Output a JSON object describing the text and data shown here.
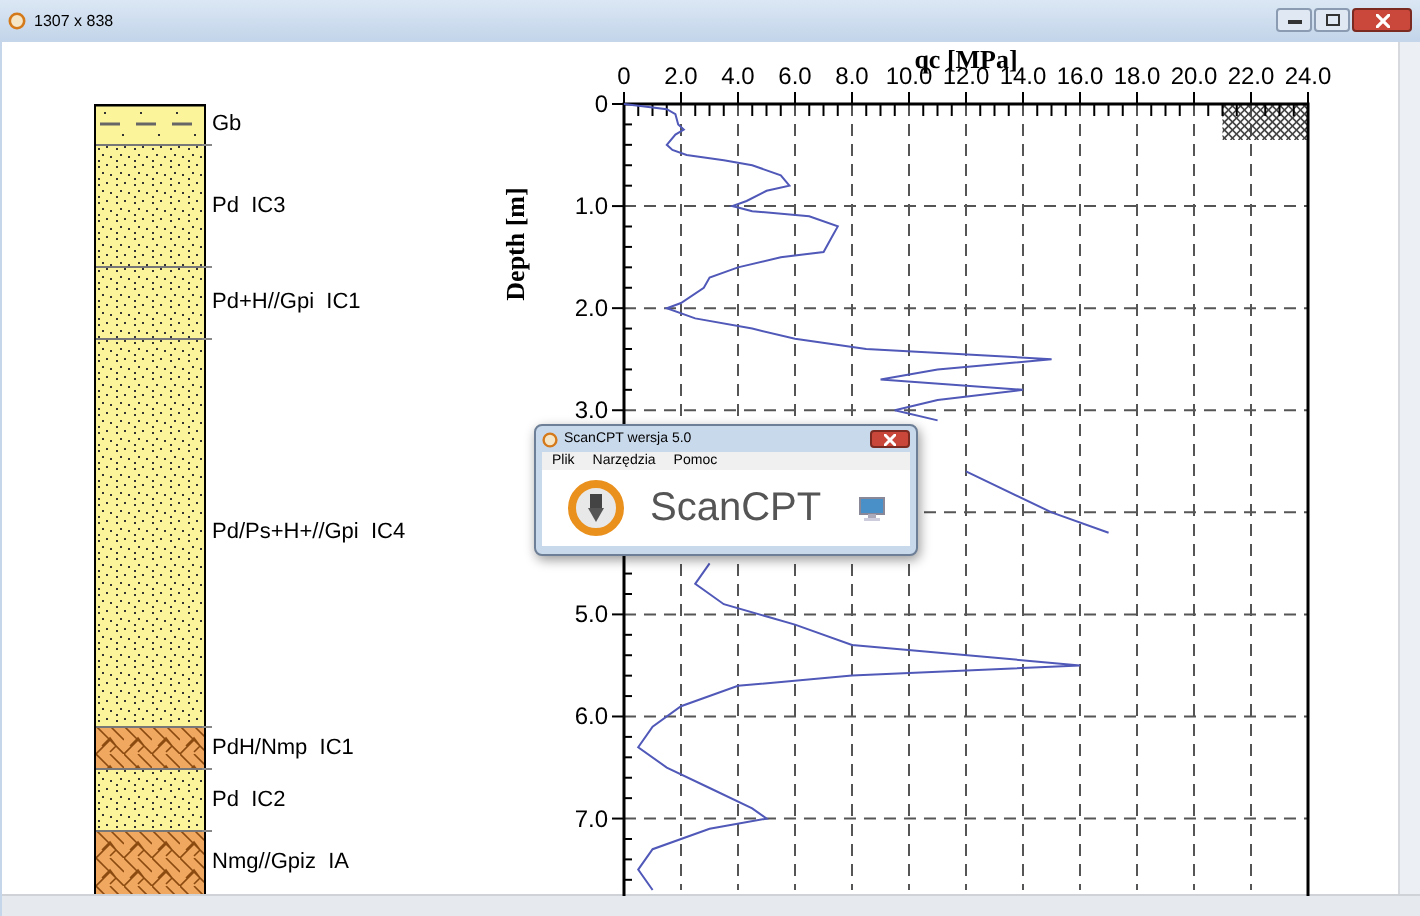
{
  "window": {
    "title": "1307 x 838"
  },
  "strata": [
    {
      "name": "Gb",
      "kind": "fill"
    },
    {
      "name": "Pd  IC3",
      "kind": "sand"
    },
    {
      "name": "Pd+H//Gpi  IC1",
      "kind": "sand"
    },
    {
      "name": "Pd/Ps+H+//Gpi  IC4",
      "kind": "sand"
    },
    {
      "name": "PdH/Nmp  IC1",
      "kind": "clay"
    },
    {
      "name": "Pd  IC2",
      "kind": "sand"
    },
    {
      "name": "Nmg//Gpiz  IA",
      "kind": "clay"
    }
  ],
  "chart": {
    "chart_data": {
      "type": "line",
      "xlabel": "qc [MPa]",
      "ylabel": "Depth [m]",
      "x": [
        0,
        1.5,
        1.8,
        1.9,
        2.1,
        1.8,
        1.5,
        1.7,
        2.2,
        3.5,
        4.5,
        5.5,
        5.8,
        5.0,
        4.3,
        3.8,
        4.5,
        6.5,
        7.5,
        7.3,
        7.0,
        5.5,
        4.0,
        3.0,
        2.8,
        2.0,
        1.5,
        2.5,
        4.5,
        6.0,
        8.5,
        15.0,
        11.0,
        9.0,
        14.0,
        11.0,
        9.5,
        11.0,
        null,
        12.0,
        15.0,
        17.0,
        null,
        3.0,
        2.5,
        3.5,
        6.0,
        8.0,
        16.0,
        8.0,
        4.0,
        2.0,
        1.0,
        0.5,
        1.5,
        3.0,
        4.5,
        5.0,
        3.0,
        1.0,
        0.5,
        1.0
      ],
      "series": [
        {
          "color": "#5058b8",
          "values": [
            0,
            0.05,
            0.1,
            0.2,
            0.25,
            0.3,
            0.4,
            0.45,
            0.5,
            0.55,
            0.6,
            0.7,
            0.8,
            0.85,
            0.95,
            1.0,
            1.05,
            1.1,
            1.2,
            1.3,
            1.45,
            1.5,
            1.6,
            1.7,
            1.8,
            1.95,
            2.0,
            2.1,
            2.2,
            2.3,
            2.4,
            2.5,
            2.6,
            2.7,
            2.8,
            2.9,
            3.0,
            3.1,
            null,
            3.6,
            4.0,
            4.2,
            null,
            4.5,
            4.7,
            4.9,
            5.1,
            5.3,
            5.5,
            5.6,
            5.7,
            5.9,
            6.1,
            6.3,
            6.5,
            6.7,
            6.9,
            7.0,
            7.1,
            7.3,
            7.5,
            7.7
          ]
        }
      ],
      "xlim": [
        0,
        24
      ],
      "ylim": [
        7.7,
        0
      ],
      "grid": true,
      "xticks": [
        {
          "value": 0,
          "label": "0"
        },
        {
          "value": 2,
          "label": "2.0"
        },
        {
          "value": 4,
          "label": "4.0"
        },
        {
          "value": 6,
          "label": "6.0"
        },
        {
          "value": 8,
          "label": "8.0"
        },
        {
          "value": 10,
          "label": "10.0"
        },
        {
          "value": 12,
          "label": "12.0"
        },
        {
          "value": 14,
          "label": "14.0"
        },
        {
          "value": 16,
          "label": "16.0"
        },
        {
          "value": 18,
          "label": "18.0"
        },
        {
          "value": 20,
          "label": "20.0"
        },
        {
          "value": 22,
          "label": "22.0"
        },
        {
          "value": 24,
          "label": "24.0"
        }
      ],
      "yticks": [
        {
          "value": 0,
          "label": "0"
        },
        {
          "value": 1,
          "label": "1.0"
        },
        {
          "value": 2,
          "label": "2.0"
        },
        {
          "value": 3,
          "label": "3.0"
        },
        {
          "value": 5,
          "label": "5.0"
        },
        {
          "value": 6,
          "label": "6.0"
        },
        {
          "value": 7,
          "label": "7.0"
        }
      ]
    }
  },
  "dialog": {
    "title": "ScanCPT wersja 5.0",
    "menu": [
      "Plik",
      "Narzędzia",
      "Pomoc"
    ],
    "logo_text": "ScanCPT"
  }
}
